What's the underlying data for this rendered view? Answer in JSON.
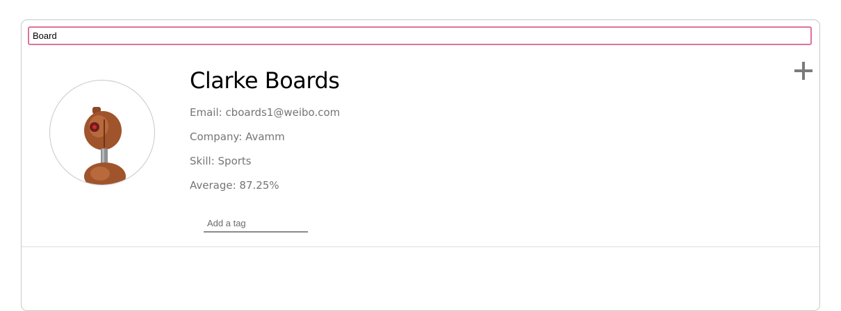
{
  "search": {
    "value": "Board"
  },
  "student": {
    "name": "Clarke Boards",
    "email": "Email: cboards1@weibo.com",
    "company": "Company: Avamm",
    "skill": "Skill: Sports",
    "average": "Average: 87.25%"
  },
  "tags": {
    "placeholder": "Add a tag"
  },
  "icons": {
    "expand": "plus-icon",
    "avatar": "robot-avatar"
  },
  "colors": {
    "search_border": "#e0709c",
    "detail_text": "#757575",
    "plus": "#7a7a7a"
  }
}
